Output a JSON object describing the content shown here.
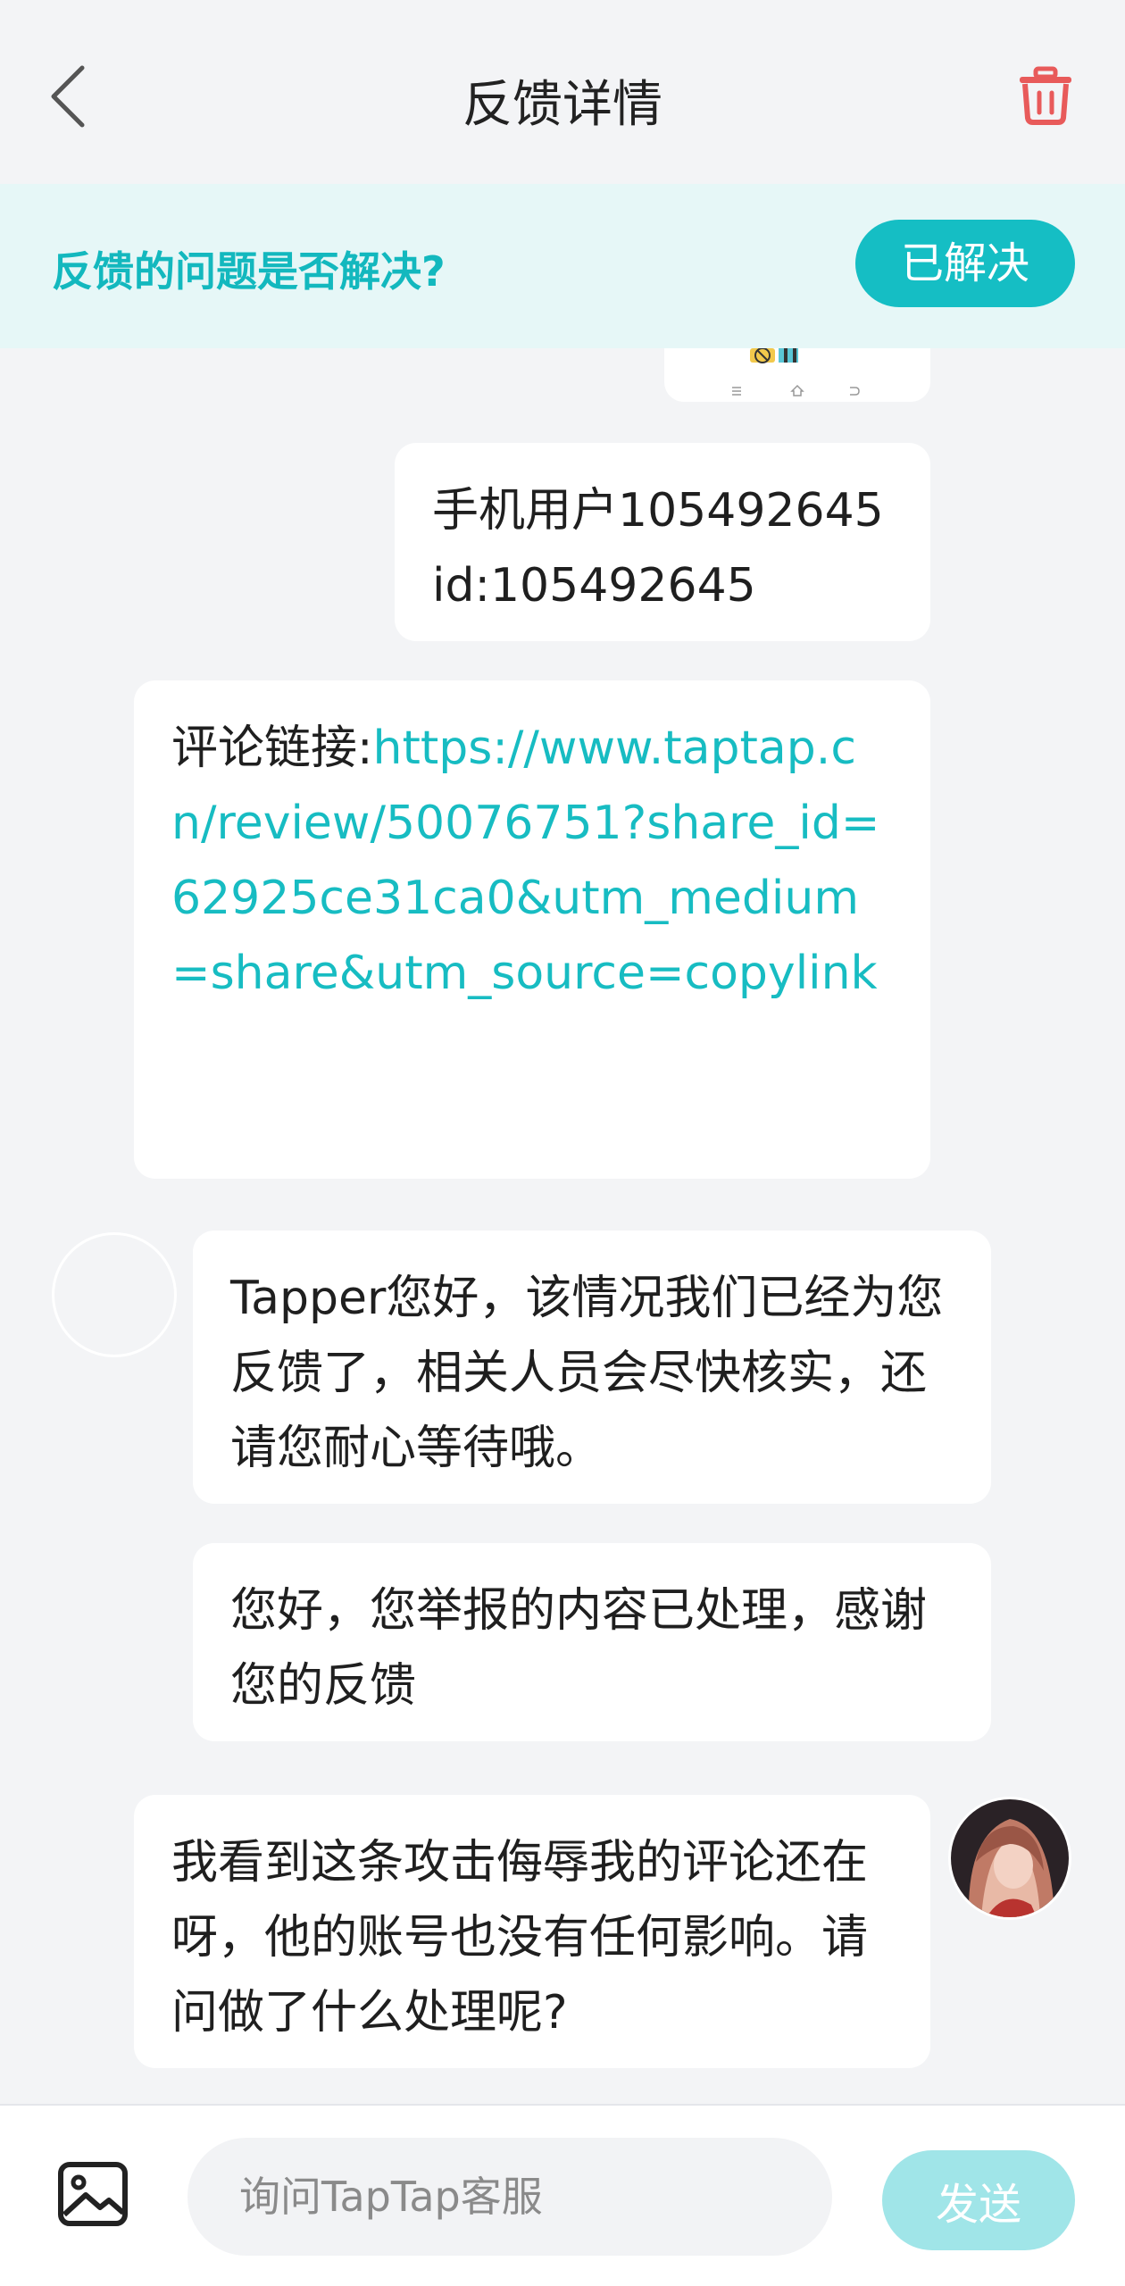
{
  "header": {
    "title": "反馈详情"
  },
  "resolve_bar": {
    "question": "反馈的问题是否解决?",
    "button_label": "已解决"
  },
  "messages": [
    {
      "sender": "user",
      "text": "手机用户105492645 id:105492645"
    },
    {
      "sender": "user",
      "prefix": "评论链接:",
      "link": "https://www.taptap.cn/review/50076751?share_id=62925ce31ca0&utm_medium=share&utm_source=copylink"
    },
    {
      "sender": "support",
      "text": "Tapper您好，该情况我们已经为您反馈了，相关人员会尽快核实，还请您耐心等待哦。"
    },
    {
      "sender": "support",
      "text": "您好，您举报的内容已处理，感谢您的反馈"
    },
    {
      "sender": "user",
      "text": "我看到这条攻击侮辱我的评论还在呀，他的账号也没有任何影响。请问做了什么处理呢?"
    }
  ],
  "composer": {
    "placeholder": "询问TapTap客服",
    "send_label": "发送"
  },
  "colors": {
    "accent": "#15bec4",
    "link": "#17bcc2",
    "delete": "#e85a5a",
    "send_disabled": "#a0e5e8"
  }
}
